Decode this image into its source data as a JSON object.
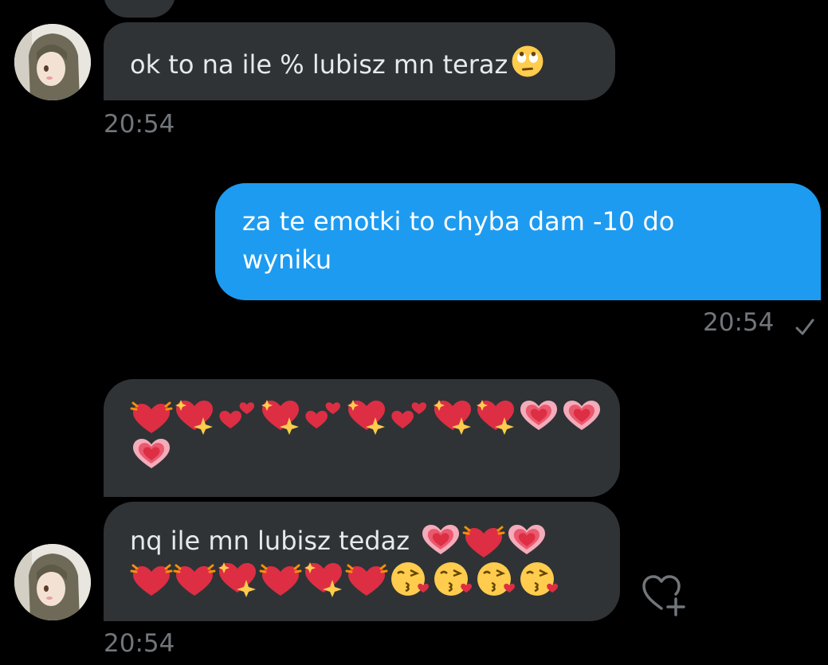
{
  "conversation": {
    "messages": [
      {
        "sender": "them",
        "text": "ok to na ile % lubisz mn teraz",
        "emoji": "face-with-rolling-eyes",
        "time": "20:54"
      },
      {
        "sender": "me",
        "lines": [
          "za te emotki to chyba dam -10 do",
          "wyniku"
        ],
        "time": "20:54",
        "status": "sent-check"
      },
      {
        "sender": "them",
        "emoji_rows": [
          [
            "beating-heart",
            "sparkling-heart",
            "two-hearts",
            "sparkling-heart",
            "two-hearts",
            "sparkling-heart",
            "two-hearts",
            "sparkling-heart",
            "sparkling-heart",
            "growing-heart",
            "growing-heart"
          ],
          [
            "growing-heart"
          ]
        ]
      },
      {
        "sender": "them",
        "text": "nq ile mn lubisz tedaz",
        "emoji_rows": [
          [
            "growing-heart",
            "beating-heart",
            "growing-heart"
          ],
          [
            "beating-heart",
            "beating-heart",
            "sparkling-heart",
            "beating-heart",
            "sparkling-heart",
            "beating-heart",
            "face-blowing-kiss",
            "face-blowing-kiss",
            "face-blowing-kiss",
            "face-blowing-kiss"
          ]
        ],
        "time": "20:54"
      }
    ]
  },
  "actions": {
    "react_icon": "heart-plus-icon"
  },
  "colors": {
    "incoming_bubble": "#2f3336",
    "outgoing_bubble": "#1d9bf0",
    "timestamp": "#71767b",
    "background": "#000000"
  }
}
